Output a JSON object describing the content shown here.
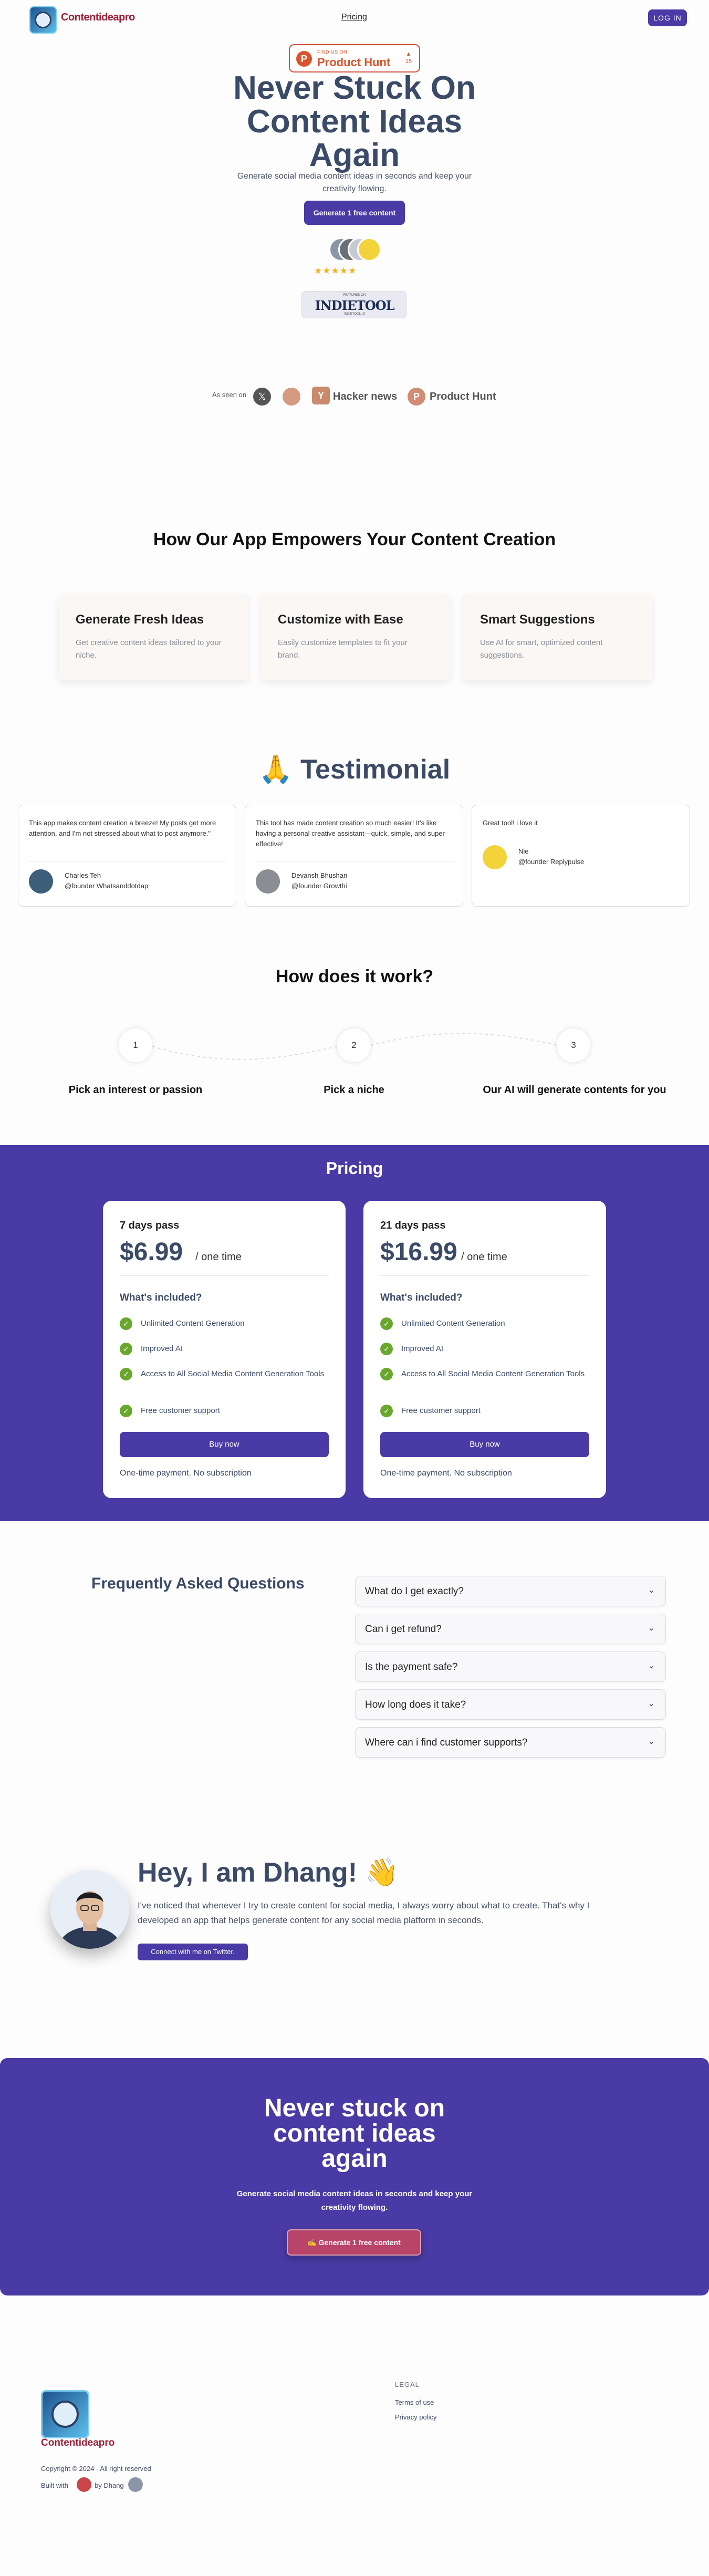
{
  "header": {
    "logo_text": "Contentideapro",
    "nav_pricing": "Pricing",
    "login_label": "LOG IN"
  },
  "hero": {
    "ph_badge_small": "FIND US ON",
    "ph_badge_big": "Product Hunt",
    "ph_badge_votes": "15",
    "ph_badge_arrow": "▲",
    "title": "Never Stuck On Content Ideas Again",
    "subtitle": "Generate social media content ideas in seconds and keep your creativity flowing.",
    "cta_label": "Generate 1 free content",
    "rating_stars": 5,
    "stars_text": "★★★★★",
    "indietool_top": "FEATURED ON",
    "indietool_name": "INDIETOOL",
    "indietool_bottom": "INDIETOOL.IO",
    "as_seen_on": "As seen on",
    "x_icon_glyph": "𝕏",
    "y_icon_glyph": "Y",
    "hacker_news": "Hacker news",
    "ph_icon_glyph": "P",
    "product_hunt": "Product Hunt"
  },
  "features": {
    "title": "How Our App Empowers Your Content Creation",
    "cards": [
      {
        "title": "Generate Fresh Ideas",
        "desc": "Get creative content ideas tailored to your niche."
      },
      {
        "title": "Customize with Ease",
        "desc": "Easily customize templates to fit your brand."
      },
      {
        "title": "Smart Suggestions",
        "desc": "Use AI for smart, optimized content suggestions."
      }
    ]
  },
  "testimonials": {
    "title": "🙏 Testimonial",
    "items": [
      {
        "quote": "This app makes content creation a breeze! My posts get more attention, and I'm not stressed about what to post anymore.\"",
        "name": "Charles Teh",
        "handle": "@founder Whatsanddotdap"
      },
      {
        "quote": "This tool has made content creation so much easier! It's like having a personal creative assistant—quick, simple, and super effective!",
        "name": "Devansh Bhushan",
        "handle": "@founder Growthi"
      },
      {
        "quote": "Great tool! i love it",
        "name": "Nie",
        "handle": "@founder Replypulse"
      }
    ]
  },
  "how": {
    "title": "How does it work?",
    "steps": [
      {
        "num": "1",
        "label": "Pick an interest or passion"
      },
      {
        "num": "2",
        "label": "Pick a niche"
      },
      {
        "num": "3",
        "label": "Our AI will generate contents for you"
      }
    ]
  },
  "pricing": {
    "title": "Pricing",
    "plans": [
      {
        "name": "7 days pass",
        "price": "$6.99",
        "period": "/ one time",
        "included_title": "What's included?",
        "features": [
          "Unlimited Content Generation",
          "Improved AI",
          "Access to All Social Media Content Generation Tools",
          "Free customer support"
        ],
        "buy_label": "Buy now",
        "note": "One-time payment. No subscription"
      },
      {
        "name": "21 days pass",
        "price": "$16.99",
        "period": "/ one time",
        "included_title": "What's included?",
        "features": [
          "Unlimited Content Generation",
          "Improved AI",
          "Access to All Social Media Content Generation Tools",
          "Free customer support"
        ],
        "buy_label": "Buy now",
        "note": "One-time payment. No subscription"
      }
    ],
    "check_glyph": "✓"
  },
  "faq": {
    "title": "Frequently Asked Questions",
    "chevron_glyph": "⌄",
    "items": [
      "What do I get exactly?",
      "Can i get refund?",
      "Is the payment safe?",
      "How long does it take?",
      "Where can i find customer supports?"
    ]
  },
  "about": {
    "title": "Hey, I am Dhang! 👋",
    "text": "I've noticed that whenever I try to create content for social media, I always worry about what to create. That's why I developed an app that helps generate content for any social media platform in seconds.",
    "button_label": "Connect with me on Twitter."
  },
  "cta": {
    "title": "Never stuck on content ideas again",
    "subtitle": "Generate social media content ideas in seconds and keep your creativity flowing.",
    "button_label": "✍️ Generate 1 free content"
  },
  "footer": {
    "logo_text": "Contentideapro",
    "copyright": "Copyright © 2024 - All right reserved",
    "built_with": "Built with",
    "by": "by Dhang",
    "legal_title": "LEGAL",
    "terms": "Terms of use",
    "privacy": "Privacy policy"
  },
  "colors": {
    "brand_primary": "#4a3aa5",
    "logo_text": "#9b2035",
    "heading": "#3b4b67",
    "check_green": "#6aa72e",
    "cta_button": "#b8446a"
  }
}
